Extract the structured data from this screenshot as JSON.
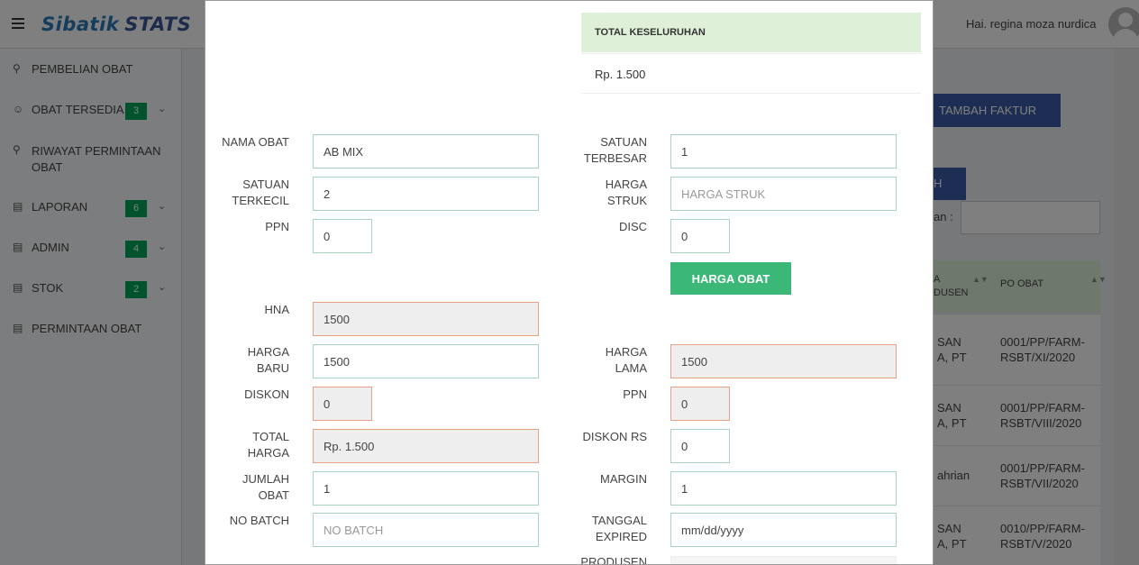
{
  "header": {
    "logo_text": "Sibatik",
    "logo_stats": "STATS",
    "greeting": "Hai. regina moza nurdica"
  },
  "sidebar": {
    "items": [
      {
        "label": "PEMBELIAN OBAT",
        "icon": "search-icon"
      },
      {
        "label": "OBAT TERSEDIA",
        "icon": "user-icon",
        "badge": "3"
      },
      {
        "label": "RIWAYAT PERMINTAAN OBAT",
        "icon": "search-icon"
      },
      {
        "label": "LAPORAN",
        "icon": "inbox-icon",
        "badge": "6"
      },
      {
        "label": "ADMIN",
        "icon": "inbox-icon",
        "badge": "4"
      },
      {
        "label": "STOK",
        "icon": "inbox-icon",
        "badge": "2"
      },
      {
        "label": "PERMINTAAN OBAT",
        "icon": "inbox-icon"
      }
    ]
  },
  "content": {
    "tambah_faktur": "TAMBAH FAKTUR",
    "cari_button": "H",
    "search_label": "an :",
    "table_headers": [
      "A\nDUSEN",
      "PO OBAT"
    ],
    "rows": [
      {
        "c1": "SAN\nA, PT",
        "c2": "0001/PP/FARM-\nRSBT/XI/2020"
      },
      {
        "c1": "SAN\nA, PT",
        "c2": "0001/PP/FARM-\nRSBT/VIII/2020"
      },
      {
        "c1": "ahrian",
        "c2": "0001/PP/FARM-\nRSBT/VII/2020"
      },
      {
        "c1": "SAN\nA, PT",
        "c2": "0010/PP/FARM-\nRSBT/V/2020"
      }
    ]
  },
  "modal": {
    "total_title": "TOTAL KESELURUHAN",
    "total_value": "Rp. 1.500",
    "fields": {
      "nama_obat": {
        "label": "NAMA OBAT",
        "value": "AB MIX"
      },
      "satuan_terbesar": {
        "label": "SATUAN TERBESAR",
        "value": "1"
      },
      "satuan_terkecil": {
        "label": "SATUAN TERKECIL",
        "value": "2"
      },
      "harga_struk": {
        "label": "HARGA STRUK",
        "value": "",
        "placeholder": "HARGA STRUK"
      },
      "ppn": {
        "label": "PPN",
        "value": "0"
      },
      "disc": {
        "label": "DISC",
        "value": "0"
      },
      "hna": {
        "label": "HNA",
        "value": "1500"
      },
      "harga_baru": {
        "label": "HARGA BARU",
        "value": "1500"
      },
      "harga_lama": {
        "label": "HARGA LAMA",
        "value": "1500"
      },
      "diskon": {
        "label": "DISKON",
        "value": "0"
      },
      "ppn2": {
        "label": "PPN",
        "value": "0"
      },
      "total_harga": {
        "label": "TOTAL HARGA",
        "value": "Rp. 1.500"
      },
      "diskon_rs": {
        "label": "DISKON RS",
        "value": "0"
      },
      "jumlah_obat": {
        "label": "JUMLAH OBAT",
        "value": "1"
      },
      "margin": {
        "label": "MARGIN",
        "value": "1"
      },
      "no_batch": {
        "label": "NO BATCH",
        "value": "",
        "placeholder": "NO BATCH"
      },
      "tanggal_expired": {
        "label": "TANGGAL EXPIRED",
        "value": "mm/dd/yyyy"
      },
      "produsen": {
        "label": "PRODUSEN"
      }
    },
    "harga_obat_button": "HARGA OBAT"
  }
}
